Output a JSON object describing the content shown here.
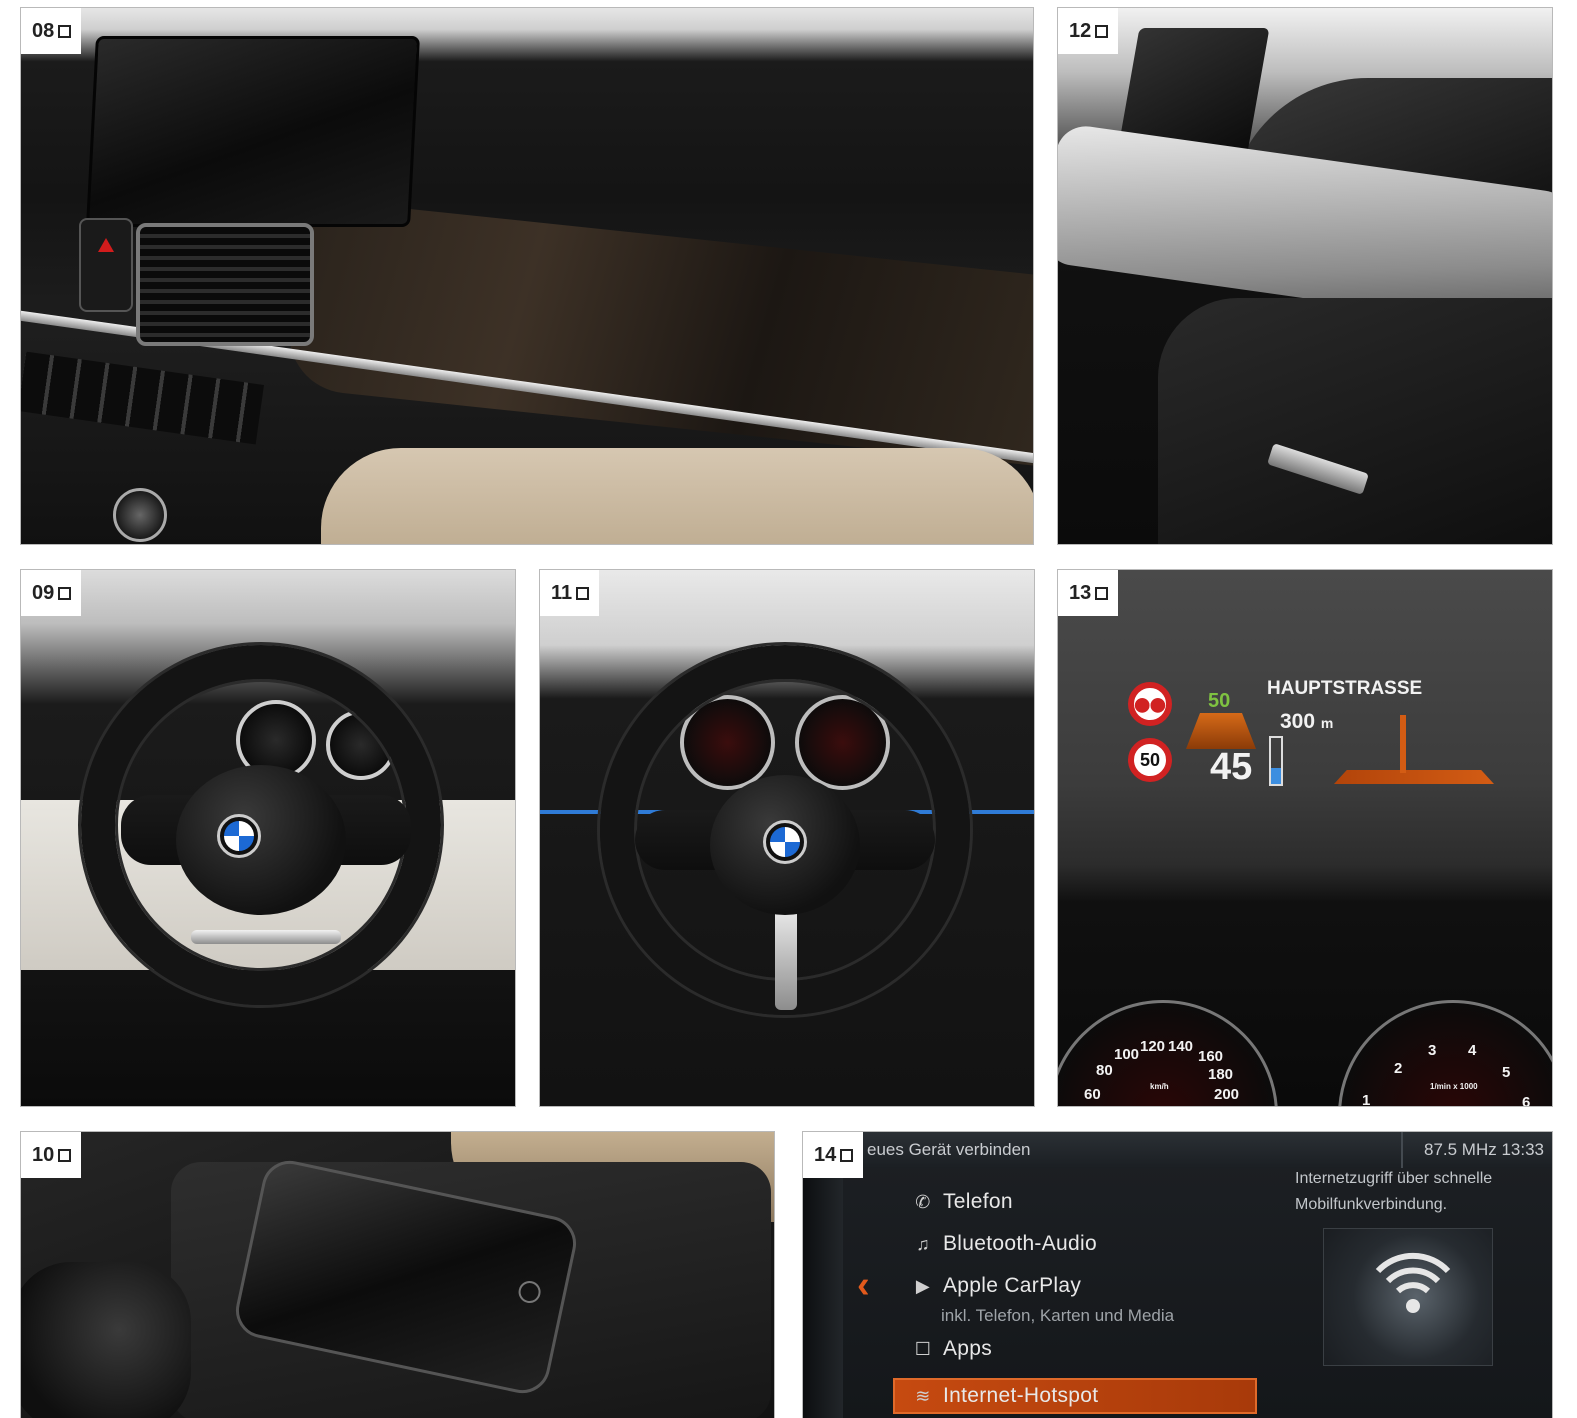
{
  "panels": {
    "p08": {
      "number": "08"
    },
    "p12": {
      "number": "12"
    },
    "p09": {
      "number": "09"
    },
    "p11": {
      "number": "11"
    },
    "p13": {
      "number": "13"
    },
    "p10": {
      "number": "10"
    },
    "p14": {
      "number": "14"
    }
  },
  "hud": {
    "street": "HAUPTSTRASSE",
    "distance_value": "300",
    "distance_unit": "m",
    "speed": "45",
    "limit_small": "50",
    "limit_sign": "50",
    "speedo_scale": [
      "60",
      "80",
      "100",
      "120",
      "140",
      "160",
      "180",
      "200"
    ],
    "speedo_unit": "km/h",
    "tacho_scale": [
      "1",
      "2",
      "3",
      "4",
      "5",
      "6"
    ],
    "tacho_unit": "1/min x 1000"
  },
  "idrive": {
    "title": "eues Gerät verbinden",
    "status": "87.5 MHz 13:33",
    "menu": [
      {
        "icon": "phone-icon",
        "glyph": "✆",
        "label": "Telefon"
      },
      {
        "icon": "music-note-icon",
        "glyph": "♫",
        "label": "Bluetooth-Audio"
      },
      {
        "icon": "play-circle-icon",
        "glyph": "▶",
        "label": "Apple CarPlay"
      },
      {
        "icon": "apps-square-icon",
        "glyph": "☐",
        "label": "Apps"
      },
      {
        "icon": "wifi-icon",
        "glyph": "≋",
        "label": "Internet-Hotspot"
      }
    ],
    "carplay_sub": "inkl. Telefon, Karten und Media",
    "info": "Internetzugriff über schnelle Mobilfunkverbindung.",
    "accent": "#c64a10"
  }
}
